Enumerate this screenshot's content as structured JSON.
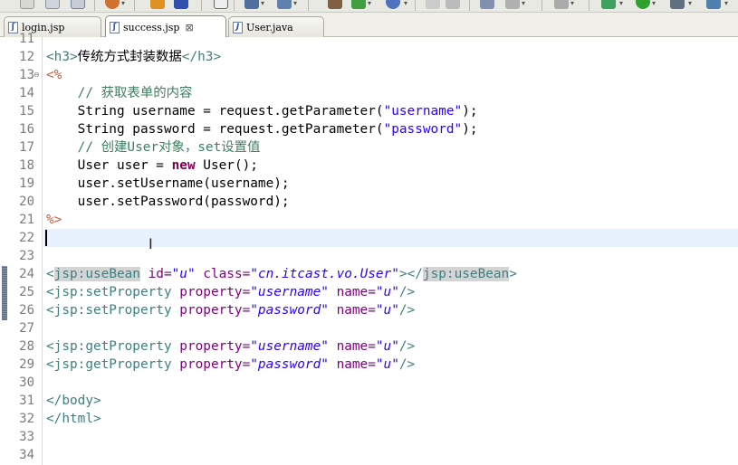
{
  "tabs": [
    {
      "label": "login.jsp",
      "icon": "jsp-file-icon",
      "active": false
    },
    {
      "label": "success.jsp",
      "icon": "jsp-file-icon",
      "active": true,
      "close": "⊠"
    },
    {
      "label": "User.java",
      "icon": "java-file-icon",
      "active": false
    }
  ],
  "editor": {
    "line_numbers": [
      "11",
      "12",
      "13",
      "14",
      "15",
      "16",
      "17",
      "18",
      "19",
      "20",
      "21",
      "22",
      "23",
      "24",
      "25",
      "26",
      "27",
      "28",
      "29",
      "30",
      "31",
      "32",
      "33",
      "34"
    ],
    "current_line": "22",
    "lines": [
      {
        "n": "11",
        "tokens": []
      },
      {
        "n": "12",
        "tokens": [
          {
            "c": "t-tag",
            "t": "<h3>"
          },
          {
            "c": "t-text",
            "t": "传统方式封装数据"
          },
          {
            "c": "t-tag",
            "t": "</h3>"
          }
        ]
      },
      {
        "n": "13",
        "tokens": [
          {
            "c": "t-jsp",
            "t": "<%"
          }
        ]
      },
      {
        "n": "14",
        "tokens": [
          {
            "c": "t-com",
            "t": "    // 获取表单的内容"
          }
        ]
      },
      {
        "n": "15",
        "tokens": [
          {
            "c": "t-text",
            "t": "    String username = request.getParameter("
          },
          {
            "c": "t-str",
            "t": "\"username\""
          },
          {
            "c": "t-text",
            "t": ");"
          }
        ]
      },
      {
        "n": "16",
        "tokens": [
          {
            "c": "t-text",
            "t": "    String password = request.getParameter("
          },
          {
            "c": "t-str",
            "t": "\"password\""
          },
          {
            "c": "t-text",
            "t": ");"
          }
        ]
      },
      {
        "n": "17",
        "tokens": [
          {
            "c": "t-com",
            "t": "    // 创建User对象，set设置值"
          }
        ]
      },
      {
        "n": "18",
        "tokens": [
          {
            "c": "t-text",
            "t": "    User user = "
          },
          {
            "c": "t-kw",
            "t": "new"
          },
          {
            "c": "t-text",
            "t": " User();"
          }
        ]
      },
      {
        "n": "19",
        "tokens": [
          {
            "c": "t-text",
            "t": "    user.setUsername(username);"
          }
        ]
      },
      {
        "n": "20",
        "tokens": [
          {
            "c": "t-text",
            "t": "    user.setPassword(password);"
          }
        ]
      },
      {
        "n": "21",
        "tokens": [
          {
            "c": "t-jsp",
            "t": "%>"
          }
        ]
      },
      {
        "n": "22",
        "tokens": []
      },
      {
        "n": "23",
        "tokens": []
      },
      {
        "n": "24",
        "tokens": [
          {
            "c": "t-tag",
            "t": "<"
          },
          {
            "c": "t-tag hl",
            "t": "jsp:useBean"
          },
          {
            "c": "t-attr",
            "t": " id="
          },
          {
            "c": "t-val",
            "t": "\"u\""
          },
          {
            "c": "t-attr",
            "t": " class="
          },
          {
            "c": "t-val",
            "t": "\"cn.itcast.vo.User\""
          },
          {
            "c": "t-tag",
            "t": "></"
          },
          {
            "c": "t-tag hl",
            "t": "jsp:useBean"
          },
          {
            "c": "t-tag",
            "t": ">"
          }
        ]
      },
      {
        "n": "25",
        "tokens": [
          {
            "c": "t-tag",
            "t": "<jsp:setProperty"
          },
          {
            "c": "t-attr",
            "t": " property="
          },
          {
            "c": "t-val",
            "t": "\"username\""
          },
          {
            "c": "t-attr",
            "t": " name="
          },
          {
            "c": "t-val",
            "t": "\"u\""
          },
          {
            "c": "t-tag",
            "t": "/>"
          }
        ]
      },
      {
        "n": "26",
        "tokens": [
          {
            "c": "t-tag",
            "t": "<jsp:setProperty"
          },
          {
            "c": "t-attr",
            "t": " property="
          },
          {
            "c": "t-val",
            "t": "\"password\""
          },
          {
            "c": "t-attr",
            "t": " name="
          },
          {
            "c": "t-val",
            "t": "\"u\""
          },
          {
            "c": "t-tag",
            "t": "/>"
          }
        ]
      },
      {
        "n": "27",
        "tokens": []
      },
      {
        "n": "28",
        "tokens": [
          {
            "c": "t-tag",
            "t": "<jsp:getProperty"
          },
          {
            "c": "t-attr",
            "t": " property="
          },
          {
            "c": "t-val",
            "t": "\"username\""
          },
          {
            "c": "t-attr",
            "t": " name="
          },
          {
            "c": "t-val",
            "t": "\"u\""
          },
          {
            "c": "t-tag",
            "t": "/>"
          }
        ]
      },
      {
        "n": "29",
        "tokens": [
          {
            "c": "t-tag",
            "t": "<jsp:getProperty"
          },
          {
            "c": "t-attr",
            "t": " property="
          },
          {
            "c": "t-val",
            "t": "\"password\""
          },
          {
            "c": "t-attr",
            "t": " name="
          },
          {
            "c": "t-val",
            "t": "\"u\""
          },
          {
            "c": "t-tag",
            "t": "/>"
          }
        ]
      },
      {
        "n": "30",
        "tokens": []
      },
      {
        "n": "31",
        "tokens": [
          {
            "c": "t-tag",
            "t": "</body>"
          }
        ]
      },
      {
        "n": "32",
        "tokens": [
          {
            "c": "t-tag",
            "t": "</html>"
          }
        ]
      },
      {
        "n": "33",
        "tokens": []
      },
      {
        "n": "34",
        "tokens": []
      }
    ],
    "colors": {
      "tag": "#3f7f7f",
      "attribute": "#7f007f",
      "attribute_value": "#2a00ff",
      "comment": "#3f7f5f",
      "keyword": "#7f0055",
      "scriptlet": "#bf5f3f",
      "current_line": "#e8f2fe"
    }
  }
}
